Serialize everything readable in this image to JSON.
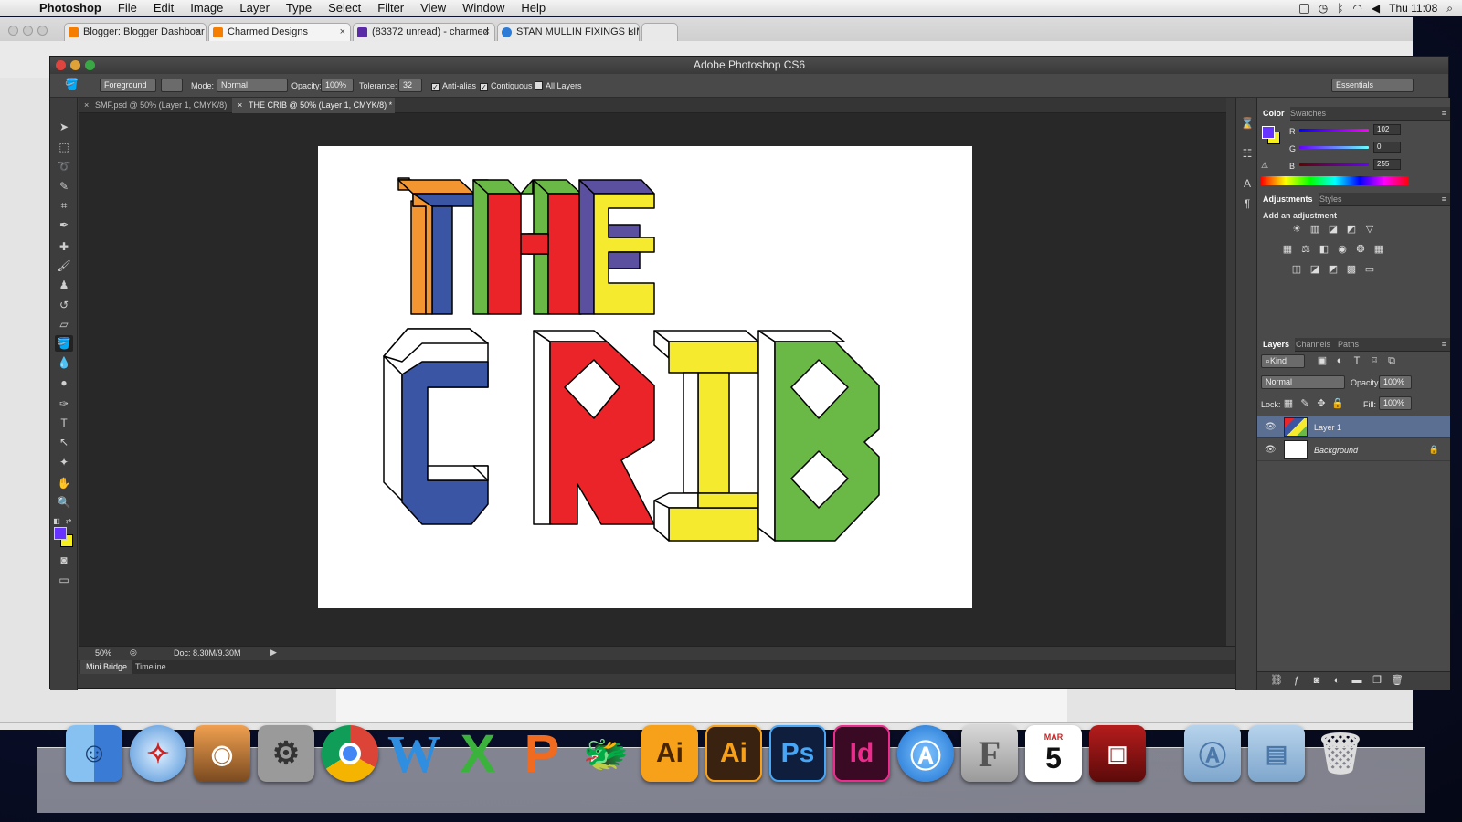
{
  "menubar": {
    "app": "Photoshop",
    "items": [
      "File",
      "Edit",
      "Image",
      "Layer",
      "Type",
      "Select",
      "Filter",
      "View",
      "Window",
      "Help"
    ],
    "clock": "Thu 11:08"
  },
  "browser": {
    "tabs": [
      {
        "label": "Blogger: Blogger Dashboar",
        "color": "#f57d00"
      },
      {
        "label": "Charmed Designs",
        "color": "#f57d00"
      },
      {
        "label": "(83372 unread) - charmed",
        "color": "#5b2aa6"
      },
      {
        "label": "STAN MULLIN FIXINGS LIMI",
        "color": "#2c7bd6"
      }
    ]
  },
  "photoshop": {
    "window_title": "Adobe Photoshop CS6",
    "options": {
      "fill_source": "Foreground",
      "mode_label": "Mode:",
      "mode_value": "Normal",
      "opacity_label": "Opacity:",
      "opacity_value": "100%",
      "tolerance_label": "Tolerance:",
      "tolerance_value": "32",
      "anti_alias": "Anti-alias",
      "contiguous": "Contiguous",
      "all_layers": "All Layers",
      "workspace": "Essentials"
    },
    "doc_tabs": [
      {
        "label": "SMF.psd @ 50% (Layer 1, CMYK/8)",
        "active": false
      },
      {
        "label": "THE CRIB @ 50% (Layer 1, CMYK/8) *",
        "active": true
      }
    ],
    "status": {
      "zoom": "50%",
      "doc": "Doc: 8.30M/9.30M"
    },
    "bottom_tabs": [
      "Mini Bridge",
      "Timeline"
    ],
    "colors": {
      "foreground": "#6633ff",
      "background": "#f5ef1e"
    },
    "color_panel": {
      "tabs": [
        "Color",
        "Swatches"
      ],
      "r_label": "R",
      "g_label": "G",
      "b_label": "B",
      "r": "102",
      "g": "0",
      "b": "255"
    },
    "adjustments": {
      "tabs": [
        "Adjustments",
        "Styles"
      ],
      "heading": "Add an adjustment"
    },
    "layers_panel": {
      "tabs": [
        "Layers",
        "Channels",
        "Paths"
      ],
      "kind": "Kind",
      "blend": "Normal",
      "opacity_label": "Opacity:",
      "opacity": "100%",
      "lock_label": "Lock:",
      "fill_label": "Fill:",
      "fill": "100%",
      "layers": [
        {
          "name": "Layer 1",
          "selected": true
        },
        {
          "name": "Background",
          "selected": false
        }
      ]
    },
    "artwork": {
      "word1": [
        "T",
        "H",
        "E"
      ],
      "word2": [
        "C",
        "R",
        "I",
        "B"
      ],
      "palette": {
        "blue": "#3b55a5",
        "red": "#ea2429",
        "yellow": "#f5ea2d",
        "green": "#6ab845",
        "orange": "#f39530",
        "purple": "#5b50a0"
      }
    }
  },
  "dock": {
    "icons": [
      {
        "name": "finder",
        "label": ""
      },
      {
        "name": "safari",
        "label": ""
      },
      {
        "name": "iphoto",
        "label": ""
      },
      {
        "name": "system-preferences",
        "label": ""
      },
      {
        "name": "chrome",
        "label": ""
      },
      {
        "name": "word",
        "label": "W"
      },
      {
        "name": "excel",
        "label": "X"
      },
      {
        "name": "powerpoint",
        "label": "P"
      },
      {
        "name": "game-center",
        "label": ""
      },
      {
        "name": "illustrator-cs",
        "label": "Ai"
      },
      {
        "name": "illustrator",
        "label": "Ai"
      },
      {
        "name": "photoshop",
        "label": "Ps"
      },
      {
        "name": "indesign",
        "label": "Id"
      },
      {
        "name": "app-store",
        "label": ""
      },
      {
        "name": "font-book",
        "label": "F"
      },
      {
        "name": "calendar",
        "label": "5",
        "sub": "MAR"
      },
      {
        "name": "photo-booth",
        "label": ""
      },
      {
        "name": "applications-folder",
        "label": ""
      },
      {
        "name": "documents-folder",
        "label": ""
      },
      {
        "name": "trash",
        "label": ""
      }
    ]
  }
}
